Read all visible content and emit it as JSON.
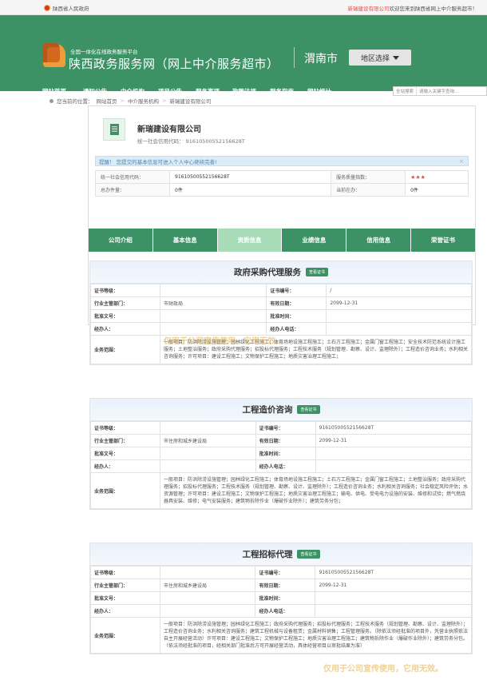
{
  "topbar": {
    "gov_name": "陕西省人民政府",
    "welcome_company": "新瑞建设有限公司",
    "welcome_suffix": "欢迎您来到陕西省网上中介服务超市！"
  },
  "header": {
    "small_title": "全国一体化在线政务服务平台",
    "main_title": "陕西政务服务网（网上中介服务超市）",
    "city": "渭南市",
    "region_button": "地区选择"
  },
  "nav": {
    "items": [
      "网站首页",
      "通知公告",
      "中介机构",
      "项目公告",
      "服务事项",
      "政策法规",
      "服务指南",
      "网站统计"
    ],
    "search_label": "全站搜索",
    "search_placeholder": "请输入关键字查询..."
  },
  "breadcrumb": {
    "prefix": "您当前的位置：",
    "items": [
      "网站首页",
      "中介服务机构",
      "新瑞建设有限公司"
    ]
  },
  "company": {
    "name": "新瑞建设有限公司",
    "credit_code_line": "统一社会信用代码： 91610500552156628T",
    "notice": "提醒！ 您提交的基本信息可进入个人中心继续完善!",
    "info": {
      "credit_label": "统一社会信用代码：",
      "credit_value": "91610500552156628T",
      "quality_label": "服务质量指数：",
      "quality_stars": "★★★",
      "total_label": "总办件量：",
      "total_value": "0件",
      "current_label": "当前在办：",
      "current_value": "0件"
    }
  },
  "tabs": [
    "公司介绍",
    "基本信息",
    "资质信息",
    "业绩信息",
    "信用信息",
    "荣誉证书"
  ],
  "labels": {
    "cert_level": "证书等级：",
    "cert_no": "证书编号：",
    "dept": "行业主管部门：",
    "valid": "有效日期：",
    "approval_no": "批准文号：",
    "approval_time": "批准时间：",
    "handler": "经办人：",
    "handler_phone": "经办人电话：",
    "scope": "业务范围：",
    "view_cert": "查看证书"
  },
  "panels": [
    {
      "title": "政府采购代理服务",
      "cert_level": "",
      "cert_no": "/",
      "dept": "市财政局",
      "valid": "2099-12-31",
      "approval_no": "",
      "approval_time": "",
      "handler": "",
      "handler_phone": "",
      "scope": "一般项目：防洪除涝设施管理；园林绿化工程施工；体育场地设施工程施工；土石方工程施工；金属门窗工程施工；安全技术防范系统设计施工服务；土地整治服务；政府采购代理服务；招投标代理服务；工程技术服务（规划管理、勘察、设计、监理除外）；工程造价咨询业务；水利相关咨询服务；许可项目：建设工程施工；文物保护工程施工；地质灾害治理工程施工；"
    },
    {
      "title": "工程造价咨询",
      "cert_level": "",
      "cert_no": "91610500552156628T",
      "dept": "市住房和城乡建设局",
      "valid": "2099-12-31",
      "approval_no": "",
      "approval_time": "",
      "handler": "",
      "handler_phone": "",
      "scope": "一般项目：防洪除涝设施管理；园林绿化工程施工；体育场地设施工程施工；土石方工程施工；金属门窗工程施工；土地整治服务；政府采购代理服务；招投标代理服务；工程技术服务（规划管理、勘察、设计、监理除外）；工程造价咨询业务；水利相关咨询服务；社会稳定风险评估；水资源管理；许可项目：建设工程施工；文物保护工程施工；地质灾害治理工程施工；输电、供电、受电电力设施的安装、维修和试验；燃气燃烧器具安装、维修；电气安装服务；建筑物拆除作业（爆破作业除外）；建筑劳务分包；"
    },
    {
      "title": "工程招标代理",
      "cert_level": "",
      "cert_no": "91610500552156628T",
      "dept": "市住房和城乡建设局",
      "valid": "2099-12-31",
      "approval_no": "",
      "approval_time": "",
      "handler": "",
      "handler_phone": "",
      "scope": "一般项目：防洪除涝设施管理；园林绿化工程施工；政府采购代理服务；招投标代理服务；工程技术服务（规划管理、勘察、设计、监理除外）；工程造价咨询业务；水利相关咨询服务；建筑工程机械与设备租赁；金属材料销售；工程管理服务。（除依法须经批准的项目外，凭营业执照依法自主开展经营活动）许可项目：建设工程施工；文物保护工程施工；地质灾害治理工程施工；建筑物拆除作业（爆破作业除外）；建筑劳务分包。（依法须经批准的项目，经相关部门批准后方可开展经营活动，具体经营项目以审批结果为准）"
    }
  ],
  "watermarks": {
    "text": "仅用于公司宣传使用，它用无效。"
  }
}
